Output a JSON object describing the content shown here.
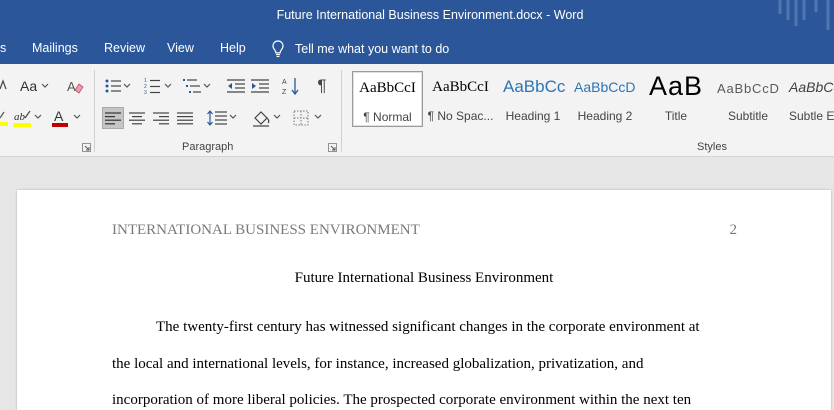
{
  "window": {
    "title": "Future International Business Environment.docx  -  Word"
  },
  "menu": {
    "tabs": [
      {
        "label": "s"
      },
      {
        "label": "Mailings"
      },
      {
        "label": "Review"
      },
      {
        "label": "View"
      },
      {
        "label": "Help"
      }
    ],
    "tell_me": "Tell me what you want to do"
  },
  "ribbon": {
    "font_group": {
      "change_case": "Aa"
    },
    "paragraph_group": {
      "label": "Paragraph"
    },
    "styles_group": {
      "label": "Styles",
      "items": [
        {
          "preview": "AaBbCcI",
          "name": "¶ Normal",
          "selected": true
        },
        {
          "preview": "AaBbCcI",
          "name": "¶ No Spac..."
        },
        {
          "preview": "AaBbCc",
          "name": "Heading 1"
        },
        {
          "preview": "AaBbCcD",
          "name": "Heading 2"
        },
        {
          "preview": "AaB",
          "name": "Title"
        },
        {
          "preview": "AaBbCcD",
          "name": "Subtitle"
        },
        {
          "preview": "AaBbCc",
          "name": "Subtle Em"
        }
      ]
    }
  },
  "colors": {
    "brand": "#2b579a",
    "font_color_bar": "#c00000",
    "highlight_bar": "#ffff00",
    "heading_blue": "#2e74b5",
    "running_head_gray": "#7a7a7a"
  },
  "document": {
    "running_head": "INTERNATIONAL BUSINESS ENVIRONMENT",
    "page_number": "2",
    "title": "Future International Business Environment",
    "lines": [
      "The twenty-first century has witnessed significant changes in the corporate environment at",
      "the local and international levels, for instance, increased globalization, privatization, and",
      "incorporation of more liberal policies. The prospected corporate environment within the next ten"
    ]
  }
}
